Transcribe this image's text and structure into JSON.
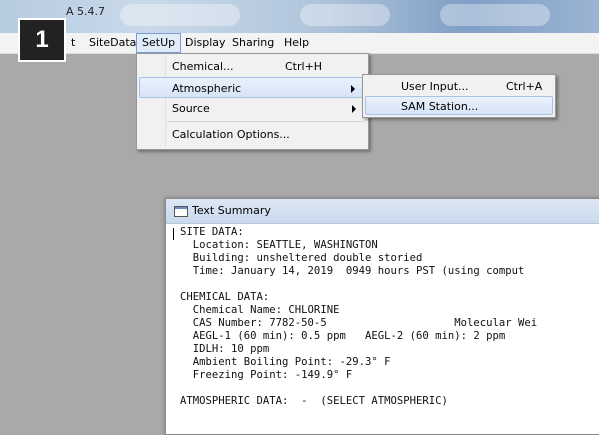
{
  "app": {
    "title": "A 5.4.7"
  },
  "step_badge": "1",
  "menubar": {
    "items": [
      {
        "label": "t"
      },
      {
        "label": "SiteData"
      },
      {
        "label": "SetUp"
      },
      {
        "label": "Display"
      },
      {
        "label": "Sharing"
      },
      {
        "label": "Help"
      }
    ]
  },
  "setup_menu": {
    "items": [
      {
        "label": "Chemical...",
        "shortcut": "Ctrl+H"
      },
      {
        "label": "Atmospheric"
      },
      {
        "label": "Source"
      },
      {
        "label": "Calculation Options..."
      }
    ]
  },
  "atmospheric_submenu": {
    "items": [
      {
        "label": "User Input...",
        "shortcut": "Ctrl+A"
      },
      {
        "label": "SAM Station..."
      }
    ]
  },
  "text_summary": {
    "title": "Text Summary",
    "lines": [
      "SITE DATA:",
      "  Location: SEATTLE, WASHINGTON",
      "  Building: unsheltered double storied",
      "  Time: January 14, 2019  0949 hours PST (using comput",
      "",
      "CHEMICAL DATA:",
      "  Chemical Name: CHLORINE",
      "  CAS Number: 7782-50-5                    Molecular Wei",
      "  AEGL-1 (60 min): 0.5 ppm   AEGL-2 (60 min): 2 ppm",
      "  IDLH: 10 ppm",
      "  Ambient Boiling Point: -29.3° F",
      "  Freezing Point: -149.9° F",
      "",
      "ATMOSPHERIC DATA:  -  (SELECT ATMOSPHERIC)"
    ]
  }
}
